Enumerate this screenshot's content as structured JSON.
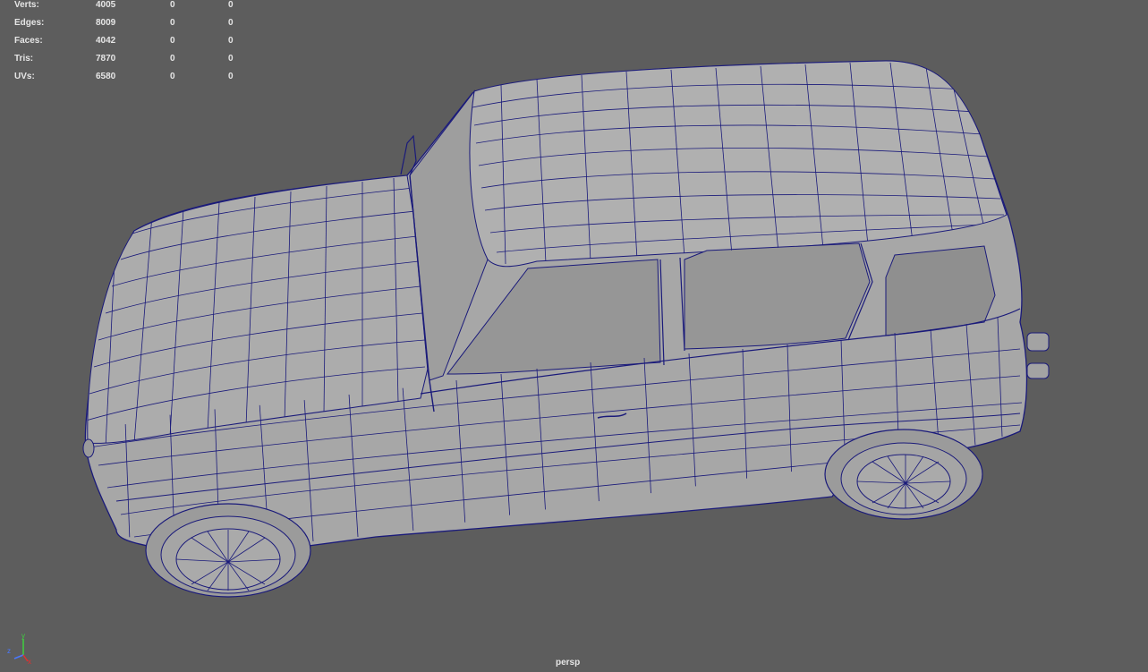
{
  "viewport": {
    "background": "#5d5d5d",
    "wire_color": "#1a1a7a",
    "camera_label": "persp"
  },
  "heads_up_display": {
    "rows": [
      {
        "label": "Verts:",
        "values": [
          "4005",
          "0",
          "0"
        ]
      },
      {
        "label": "Edges:",
        "values": [
          "8009",
          "0",
          "0"
        ]
      },
      {
        "label": "Faces:",
        "values": [
          "4042",
          "0",
          "0"
        ]
      },
      {
        "label": "Tris:",
        "values": [
          "7870",
          "0",
          "0"
        ]
      },
      {
        "label": "UVs:",
        "values": [
          "6580",
          "0",
          "0"
        ]
      }
    ]
  },
  "axis_gizmo": {
    "x": "x",
    "y": "y",
    "z": "z"
  }
}
